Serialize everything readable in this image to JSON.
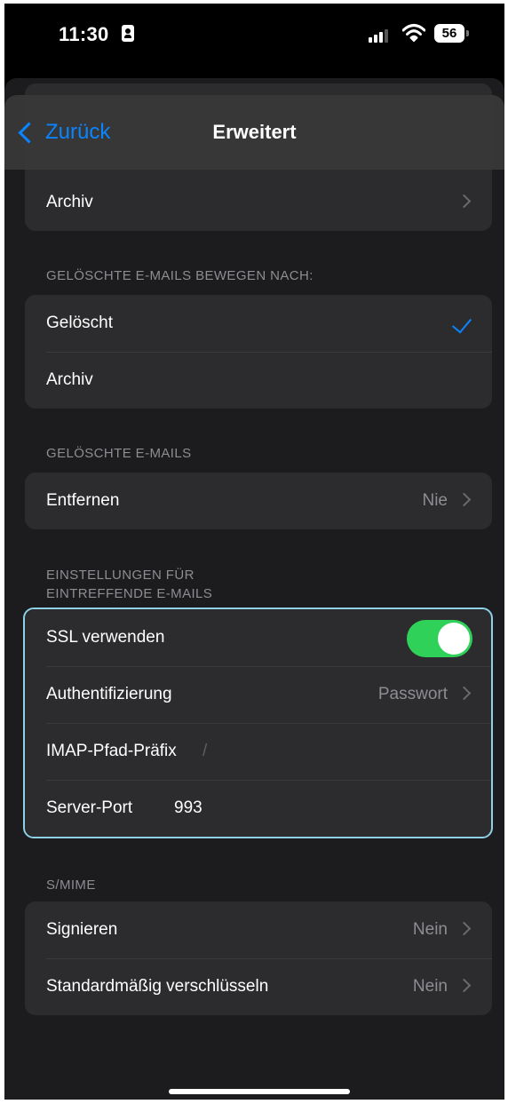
{
  "status_bar": {
    "time": "11:30",
    "battery": "56"
  },
  "nav": {
    "back_label": "Zurück",
    "title": "Erweitert"
  },
  "top_group": {
    "archiv_label": "Archiv"
  },
  "deleted_move": {
    "header": "GELÖSCHTE E-MAILS BEWEGEN NACH:",
    "options": [
      {
        "label": "Gelöscht",
        "selected": true
      },
      {
        "label": "Archiv",
        "selected": false
      }
    ]
  },
  "deleted_mails": {
    "header": "GELÖSCHTE E-MAILS",
    "remove_label": "Entfernen",
    "remove_value": "Nie"
  },
  "incoming": {
    "header_line1": "EINSTELLUNGEN FÜR",
    "header_line2": "EINTREFFENDE E-MAILS",
    "ssl_label": "SSL verwenden",
    "ssl_enabled": true,
    "auth_label": "Authentifizierung",
    "auth_value": "Passwort",
    "imap_label": "IMAP-Pfad-Präfix",
    "imap_value": "/",
    "port_label": "Server-Port",
    "port_value": "993"
  },
  "smime": {
    "header": "S/MIME",
    "sign_label": "Signieren",
    "sign_value": "Nein",
    "encrypt_label": "Standardmäßig verschlüsseln",
    "encrypt_value": "Nein"
  },
  "colors": {
    "accent": "#0a84ff",
    "toggle_on": "#30d158",
    "focus_ring": "#8ed0e6",
    "cell": "#2c2c2e",
    "background": "#1c1c1e"
  }
}
